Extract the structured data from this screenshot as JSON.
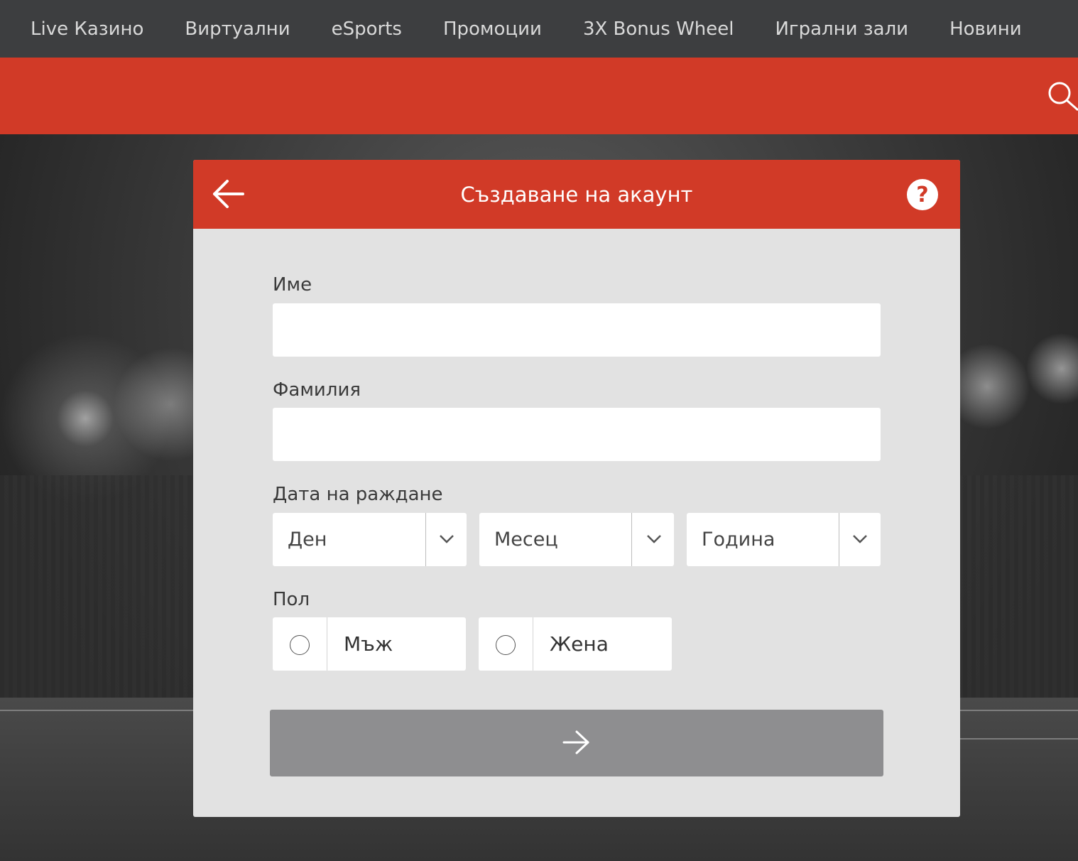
{
  "nav": {
    "items": [
      "Live Казино",
      "Виртуални",
      "eSports",
      "Промоции",
      "3X Bonus Wheel",
      "Игрални зали",
      "Новини"
    ]
  },
  "modal": {
    "title": "Създаване на акаунт",
    "first_name_label": "Име",
    "first_name_value": "",
    "last_name_label": "Фамилия",
    "last_name_value": "",
    "dob_label": "Дата на раждане",
    "day": "Ден",
    "month": "Месец",
    "year": "Година",
    "gender_label": "Пол",
    "gender_male": "Мъж",
    "gender_female": "Жена"
  },
  "icons": {
    "back": "arrow-left-icon",
    "help": "question-circle-icon",
    "search": "search-icon",
    "chevron": "chevron-down-icon",
    "next": "arrow-right-icon"
  },
  "colors": {
    "brand_red": "#d13a27",
    "nav_bg": "#3d3e40",
    "panel_bg": "#e2e2e2",
    "button_disabled": "#8e8e90"
  }
}
